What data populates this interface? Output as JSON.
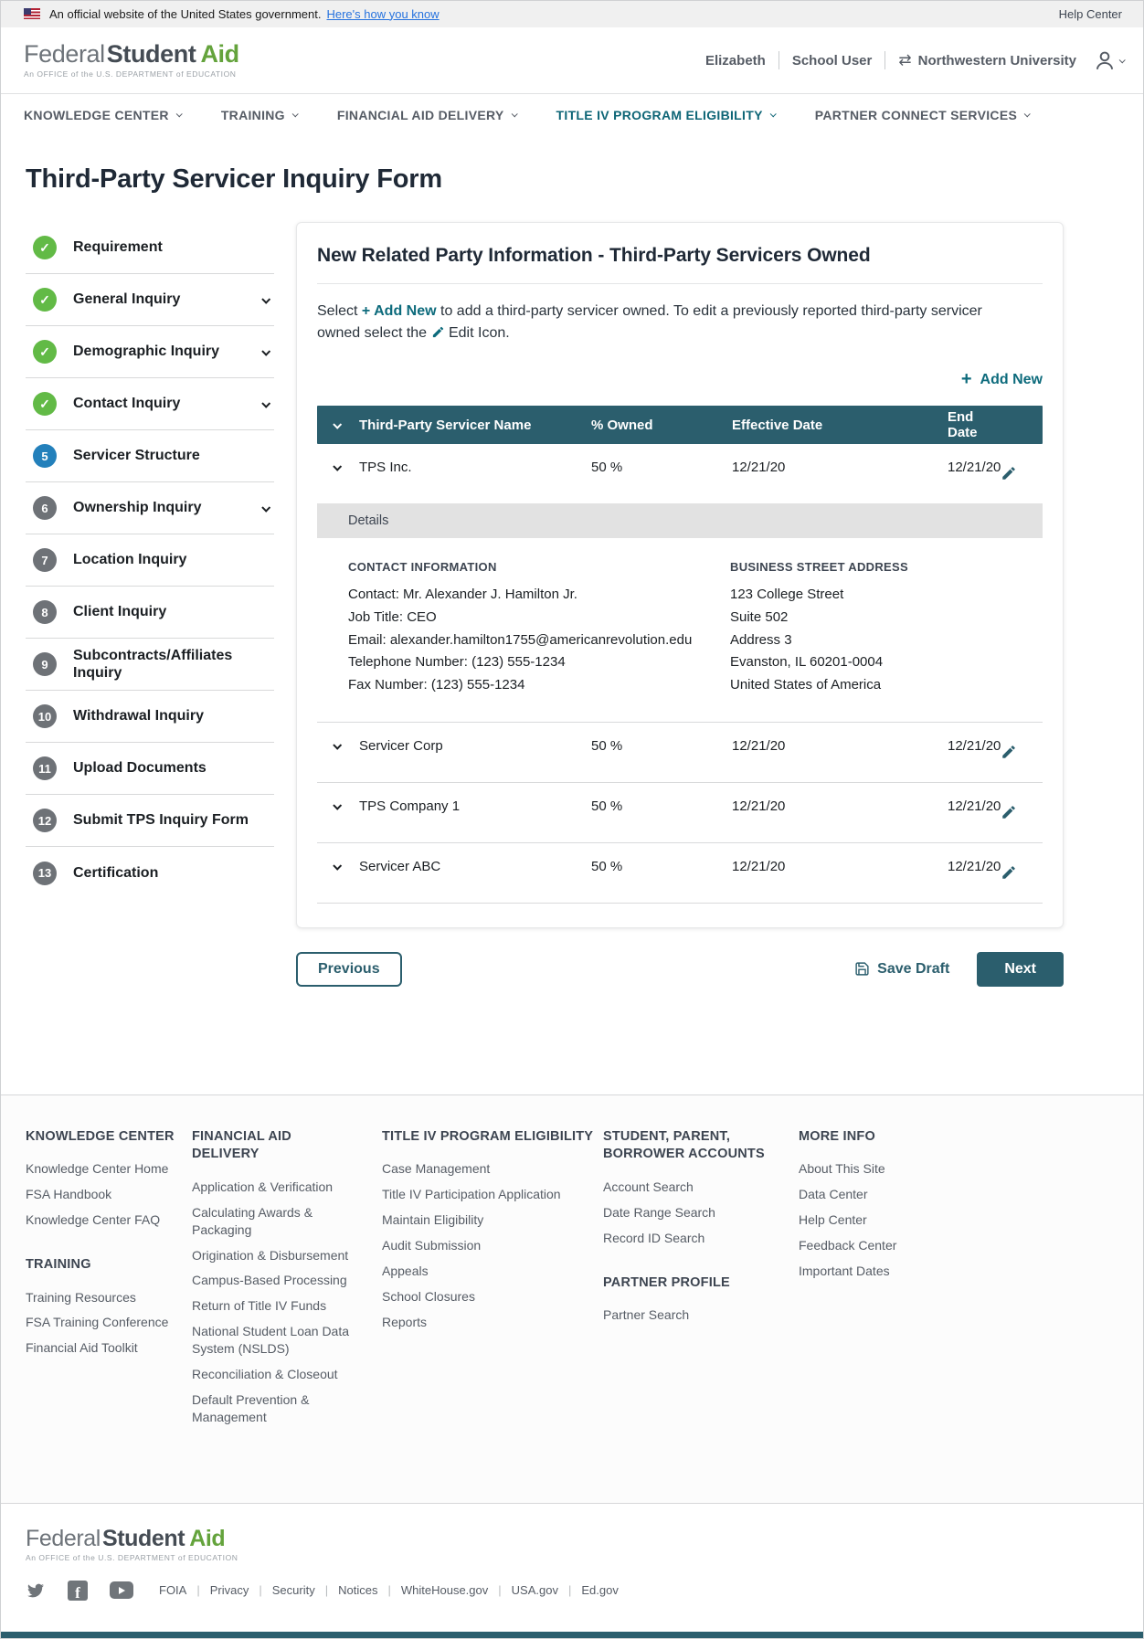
{
  "colors": {
    "accent_teal": "#2b5e6d",
    "link_blue": "#2672de",
    "success_green": "#62ba46",
    "current_step_blue": "#2380bb",
    "brand_green": "#64a33c"
  },
  "banner": {
    "text": "An official website of the United States government.",
    "link": "Here's how you know",
    "help_center": "Help Center"
  },
  "header": {
    "logo": {
      "word1": "Federal",
      "word2": "Student",
      "word3": "Aid",
      "tagline": "An OFFICE of the U.S. DEPARTMENT of EDUCATION"
    },
    "user": {
      "name": "Elizabeth",
      "role": "School User",
      "organization": "Northwestern University"
    }
  },
  "nav": {
    "items": [
      "KNOWLEDGE CENTER",
      "TRAINING",
      "FINANCIAL AID DELIVERY",
      "TITLE IV PROGRAM ELIGIBILITY",
      "PARTNER CONNECT SERVICES"
    ]
  },
  "page": {
    "title": "Third-Party Servicer Inquiry Form"
  },
  "sidebar": {
    "steps": [
      {
        "label": "Requirement",
        "status": "complete"
      },
      {
        "label": "General Inquiry",
        "status": "complete"
      },
      {
        "label": "Demographic Inquiry",
        "status": "complete"
      },
      {
        "label": "Contact Inquiry",
        "status": "complete"
      },
      {
        "number": "5",
        "label": "Servicer Structure",
        "status": "current"
      },
      {
        "number": "6",
        "label": "Ownership Inquiry",
        "status": "upcoming"
      },
      {
        "number": "7",
        "label": "Location Inquiry",
        "status": "upcoming"
      },
      {
        "number": "8",
        "label": "Client Inquiry",
        "status": "upcoming"
      },
      {
        "number": "9",
        "label": "Subcontracts/Affiliates Inquiry",
        "status": "upcoming"
      },
      {
        "number": "10",
        "label": "Withdrawal Inquiry",
        "status": "upcoming"
      },
      {
        "number": "11",
        "label": "Upload Documents",
        "status": "upcoming"
      },
      {
        "number": "12",
        "label": "Submit TPS Inquiry Form",
        "status": "upcoming"
      },
      {
        "number": "13",
        "label": "Certification",
        "status": "upcoming"
      }
    ]
  },
  "card": {
    "title": "New Related Party Information - Third-Party Servicers Owned",
    "intro": {
      "part1": "Select ",
      "add_new": "+ Add New",
      "part2": " to add a third-party servicer owned. To edit a previously reported third-party servicer owned select the ",
      "part3": " Edit Icon."
    },
    "add_new_button": "Add New",
    "table": {
      "headers": [
        "Third-Party Servicer Name",
        "% Owned",
        "Effective Date",
        "End Date"
      ],
      "rows": [
        {
          "name": "TPS Inc.",
          "owned": "50 %",
          "effective_date": "12/21/20",
          "end_date": "12/21/20"
        },
        {
          "name": "Servicer Corp",
          "owned": "50 %",
          "effective_date": "12/21/20",
          "end_date": "12/21/20"
        },
        {
          "name": "TPS Company 1",
          "owned": "50 %",
          "effective_date": "12/21/20",
          "end_date": "12/21/20"
        },
        {
          "name": "Servicer ABC",
          "owned": "50 %",
          "effective_date": "12/21/20",
          "end_date": "12/21/20"
        }
      ]
    },
    "details": {
      "label": "Details",
      "contact": {
        "heading": "CONTACT INFORMATION",
        "lines": [
          "Contact: Mr. Alexander J. Hamilton Jr.",
          "Job Title: CEO",
          "Email: alexander.hamilton1755@americanrevolution.edu",
          "Telephone Number: (123) 555-1234",
          "Fax Number: (123) 555-1234"
        ]
      },
      "address": {
        "heading": "BUSINESS STREET ADDRESS",
        "lines": [
          "123 College Street",
          "Suite 502",
          "Address 3",
          "Evanston, IL 60201-0004",
          "United States of America"
        ]
      }
    }
  },
  "actions": {
    "previous": "Previous",
    "save_draft": "Save Draft",
    "next": "Next"
  },
  "footer": {
    "columns": [
      {
        "sections": [
          {
            "heading": "KNOWLEDGE CENTER",
            "links": [
              "Knowledge Center Home",
              "FSA Handbook",
              "Knowledge Center FAQ"
            ]
          },
          {
            "heading": "TRAINING",
            "links": [
              "Training Resources",
              "FSA Training Conference",
              "Financial Aid Toolkit"
            ]
          }
        ]
      },
      {
        "sections": [
          {
            "heading": "FINANCIAL AID DELIVERY",
            "links": [
              "Application & Verification",
              "Calculating Awards & Packaging",
              "Origination & Disbursement",
              "Campus-Based Processing",
              "Return of Title IV Funds",
              "National Student Loan Data System (NSLDS)",
              "Reconciliation & Closeout",
              "Default Prevention & Management"
            ]
          }
        ]
      },
      {
        "sections": [
          {
            "heading": "TITLE IV PROGRAM ELIGIBILITY",
            "links": [
              "Case Management",
              "Title IV Participation Application",
              "Maintain Eligibility",
              "Audit Submission",
              "Appeals",
              "School Closures",
              "Reports"
            ]
          }
        ]
      },
      {
        "sections": [
          {
            "heading": "STUDENT, PARENT, BORROWER ACCOUNTS",
            "links": [
              "Account Search",
              "Date Range Search",
              "Record ID Search"
            ]
          },
          {
            "heading": "PARTNER PROFILE",
            "links": [
              "Partner Search"
            ]
          }
        ]
      },
      {
        "sections": [
          {
            "heading": "MORE INFO",
            "links": [
              "About This Site",
              "Data Center",
              "Help Center",
              "Feedback Center",
              "Important Dates"
            ]
          }
        ]
      }
    ]
  },
  "bottom": {
    "links": [
      "FOIA",
      "Privacy",
      "Security",
      "Notices",
      "WhiteHouse.gov",
      "USA.gov",
      "Ed.gov"
    ]
  }
}
